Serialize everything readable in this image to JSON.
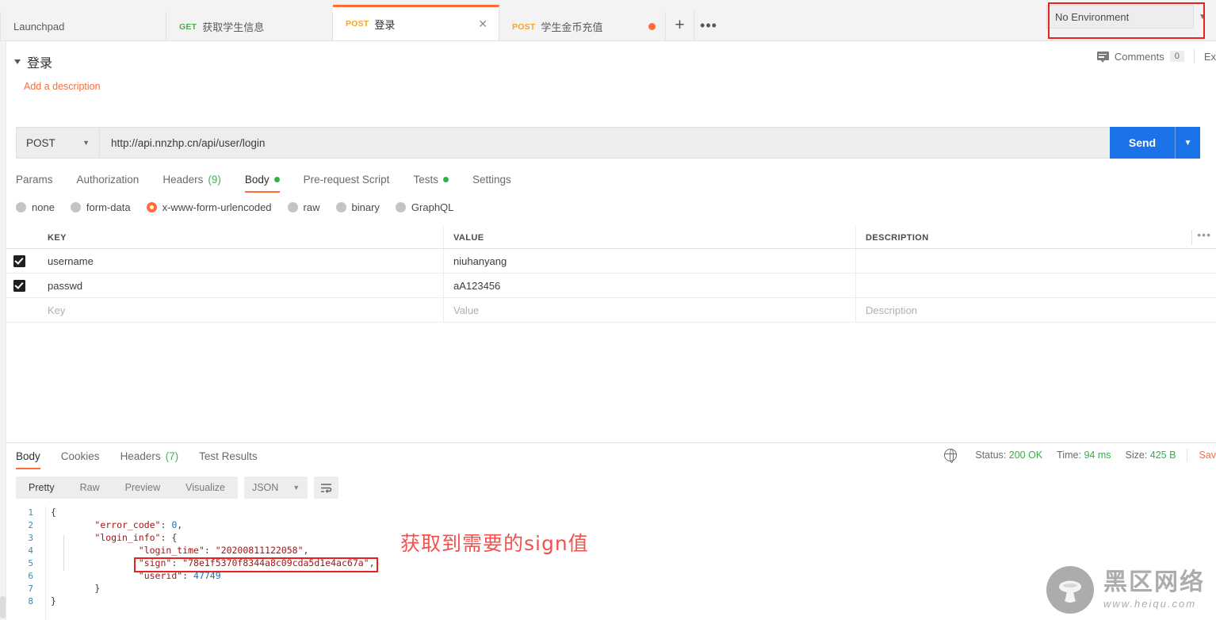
{
  "tabbar": {
    "tabs": [
      {
        "method": "",
        "name": "Launchpad",
        "active": false,
        "dirty": false,
        "closable": false
      },
      {
        "method": "GET",
        "name": "获取学生信息",
        "active": false,
        "dirty": false,
        "closable": false
      },
      {
        "method": "POST",
        "name": "登录",
        "active": true,
        "dirty": false,
        "closable": true
      },
      {
        "method": "POST",
        "name": "学生金币充值",
        "active": false,
        "dirty": true,
        "closable": false
      }
    ],
    "new_tab_label": "+",
    "more_label": "•••",
    "close_label": "✕"
  },
  "environment": {
    "selected": "No Environment",
    "caret": "▼",
    "highlight_color": "#e8231f"
  },
  "request": {
    "title": "登录",
    "description_link": "Add a description",
    "comments_label": "Comments",
    "comments_count": "0",
    "examples_label": "Ex",
    "method": "POST",
    "url": "http://api.nnzhp.cn/api/user/login",
    "send_label": "Send",
    "send_caret": "▼",
    "tabs": [
      {
        "label": "Params",
        "count": "",
        "dot": false,
        "active": false
      },
      {
        "label": "Authorization",
        "count": "",
        "dot": false,
        "active": false
      },
      {
        "label": "Headers",
        "count": "(9)",
        "dot": false,
        "active": false
      },
      {
        "label": "Body",
        "count": "",
        "dot": true,
        "active": true
      },
      {
        "label": "Pre-request Script",
        "count": "",
        "dot": false,
        "active": false
      },
      {
        "label": "Tests",
        "count": "",
        "dot": true,
        "active": false
      },
      {
        "label": "Settings",
        "count": "",
        "dot": false,
        "active": false
      }
    ],
    "body_types": [
      {
        "label": "none",
        "selected": false
      },
      {
        "label": "form-data",
        "selected": false
      },
      {
        "label": "x-www-form-urlencoded",
        "selected": true
      },
      {
        "label": "raw",
        "selected": false
      },
      {
        "label": "binary",
        "selected": false
      },
      {
        "label": "GraphQL",
        "selected": false
      }
    ],
    "table": {
      "headers": {
        "key": "KEY",
        "value": "VALUE",
        "description": "DESCRIPTION"
      },
      "bulk_edit_icon": "•••",
      "rows": [
        {
          "checked": true,
          "key": "username",
          "value": "niuhanyang",
          "description": ""
        },
        {
          "checked": true,
          "key": "passwd",
          "value": "aA123456",
          "description": ""
        }
      ],
      "placeholder_row": {
        "key": "Key",
        "value": "Value",
        "description": "Description"
      }
    }
  },
  "response": {
    "tabs": [
      {
        "label": "Body",
        "count": "",
        "active": true
      },
      {
        "label": "Cookies",
        "count": "",
        "active": false
      },
      {
        "label": "Headers",
        "count": "(7)",
        "active": false
      },
      {
        "label": "Test Results",
        "count": "",
        "active": false
      }
    ],
    "meta": {
      "status_label": "Status:",
      "status_value": "200 OK",
      "time_label": "Time:",
      "time_value": "94 ms",
      "size_label": "Size:",
      "size_value": "425 B",
      "save_label": "Sav"
    },
    "view_modes": [
      {
        "label": "Pretty",
        "active": true
      },
      {
        "label": "Raw",
        "active": false
      },
      {
        "label": "Preview",
        "active": false
      },
      {
        "label": "Visualize",
        "active": false
      }
    ],
    "format": "JSON",
    "format_caret": "▼",
    "body_lines": [
      {
        "num": "1",
        "indent": 0,
        "text": "{"
      },
      {
        "num": "2",
        "indent": 8,
        "key": "\"error_code\"",
        "sep": ": ",
        "val": "0",
        "val_type": "num",
        "tail": ","
      },
      {
        "num": "3",
        "indent": 8,
        "key": "\"login_info\"",
        "sep": ": ",
        "val": "{",
        "val_type": "pun",
        "tail": ""
      },
      {
        "num": "4",
        "indent": 16,
        "key": "\"login_time\"",
        "sep": ": ",
        "val": "\"20200811122058\"",
        "val_type": "str",
        "tail": ","
      },
      {
        "num": "5",
        "indent": 16,
        "key": "\"sign\"",
        "sep": ": ",
        "val": "\"78e1f5370f8344a8c09cda5d1e4ac67a\"",
        "val_type": "str",
        "tail": ","
      },
      {
        "num": "6",
        "indent": 16,
        "key": "\"userid\"",
        "sep": ": ",
        "val": "47749",
        "val_type": "num",
        "tail": ""
      },
      {
        "num": "7",
        "indent": 8,
        "text": "}"
      },
      {
        "num": "8",
        "indent": 0,
        "text": "}"
      }
    ]
  },
  "annotation": {
    "text": "获取到需要的sign值",
    "color": "#f4514d"
  },
  "watermark": {
    "brand": "黑区网络",
    "url": "www.heiqu.com"
  }
}
